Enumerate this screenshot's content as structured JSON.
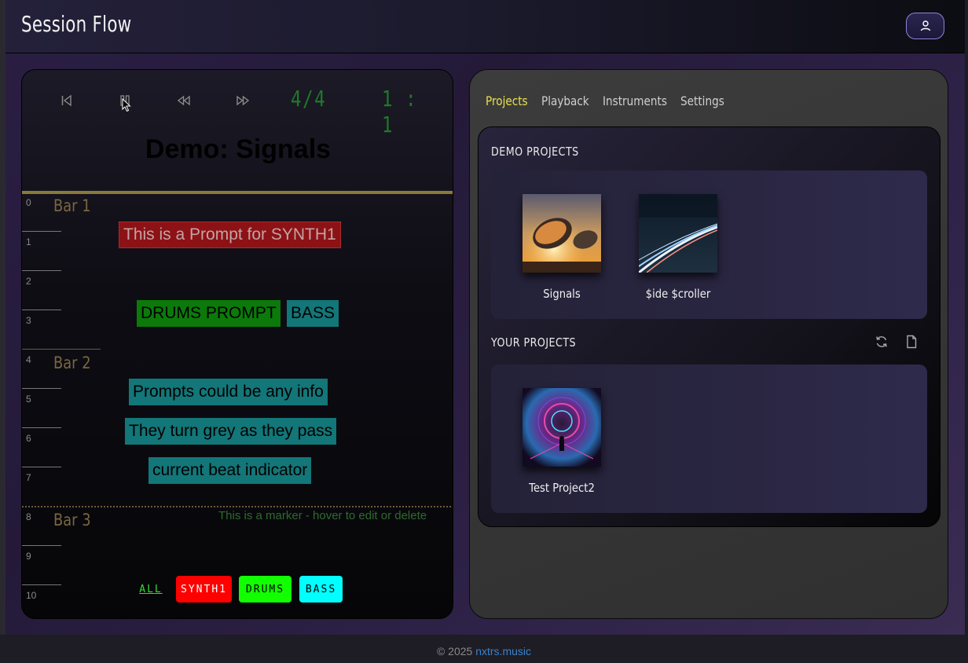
{
  "app": {
    "title": "Session Flow"
  },
  "transport": {
    "time_signature": "4/4",
    "position": "1 : 1"
  },
  "song": {
    "title": "Demo: Signals"
  },
  "timeline": {
    "beats": [
      "0",
      "1",
      "2",
      "3",
      "4",
      "5",
      "6",
      "7",
      "8",
      "9",
      "10"
    ],
    "bars": [
      "Bar 1",
      "Bar 2",
      "Bar 3"
    ],
    "marker_text": "This is a marker - hover to edit or delete"
  },
  "prompts": [
    {
      "text": "This is a Prompt for SYNTH1",
      "track": "SYNTH1"
    },
    {
      "text": "DRUMS PROMPT",
      "track": "DRUMS"
    },
    {
      "text": "BASS",
      "track": "BASS"
    },
    {
      "text": "Prompts could be any info",
      "track": "BASS"
    },
    {
      "text": "They turn grey as they pass",
      "track": "BASS"
    },
    {
      "text": "current beat indicator",
      "track": "BASS"
    }
  ],
  "filters": {
    "all": "ALL",
    "synth": "SYNTH1",
    "drums": "DRUMS",
    "bass": "BASS",
    "colors": {
      "synth": "#ff0000",
      "drums": "#11ff00",
      "bass": "#00ffff"
    }
  },
  "tabs": [
    "Projects",
    "Playback",
    "Instruments",
    "Settings"
  ],
  "active_tab": "Projects",
  "demo_projects": {
    "title": "DEMO PROJECTS",
    "items": [
      {
        "name": "Signals"
      },
      {
        "name": "$ide $croller"
      }
    ]
  },
  "your_projects": {
    "title": "YOUR PROJECTS",
    "items": [
      {
        "name": "Test Project2"
      }
    ]
  },
  "footer": {
    "copyright": "© 2025 ",
    "link": "nxtrs.music"
  },
  "colors": {
    "accent_tab": "#e8e04a",
    "lcd": "#1f7a2a",
    "footer_link": "#3b83c8"
  }
}
